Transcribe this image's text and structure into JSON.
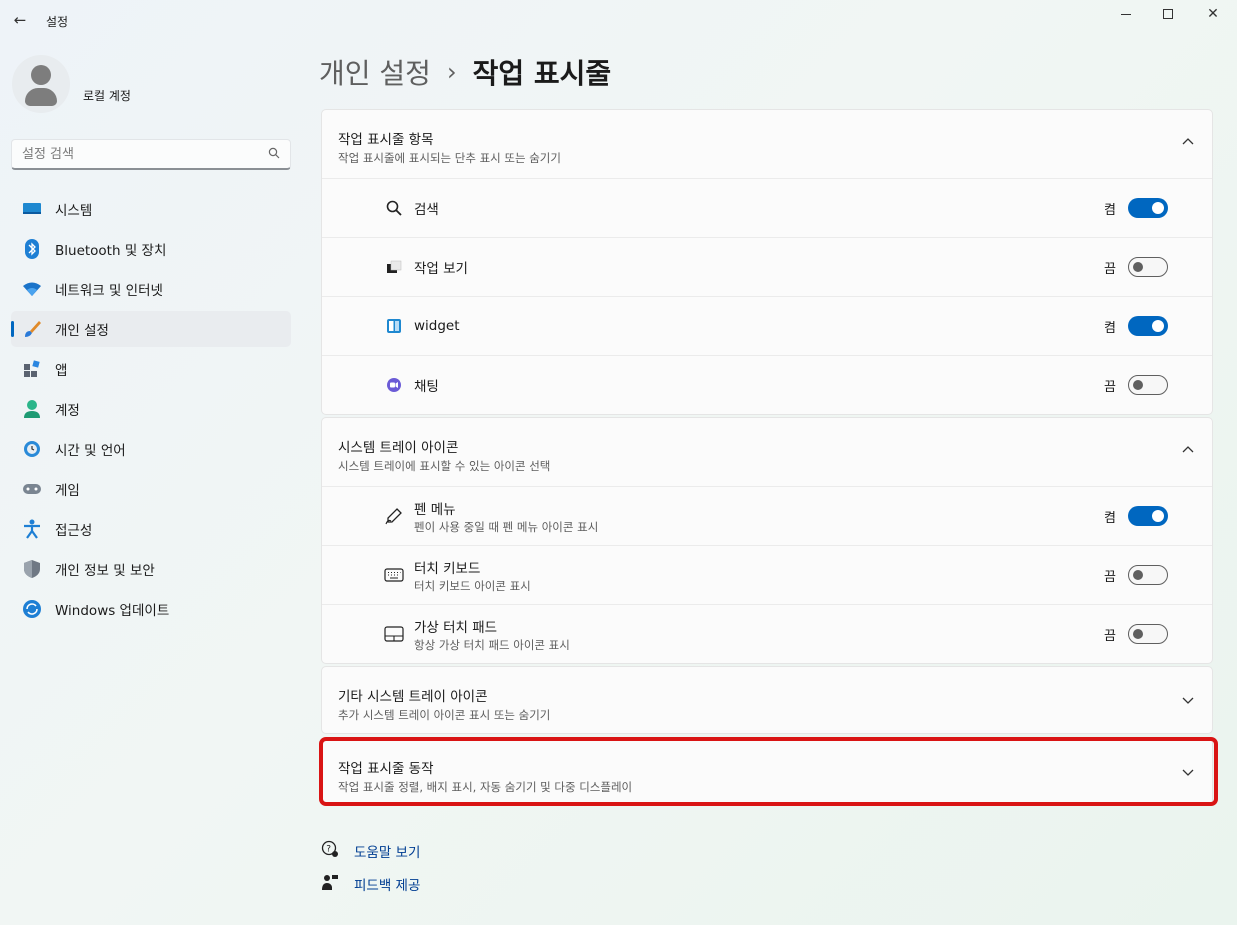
{
  "window": {
    "title": "설정",
    "back_icon": "←",
    "minimize_icon": "—",
    "maximize_icon": "☐",
    "close_icon": "✕"
  },
  "profile": {
    "name": "로컬 계정"
  },
  "search": {
    "placeholder": "설정 검색",
    "icon": "⌕"
  },
  "sidebar": {
    "items": [
      {
        "label": "시스템",
        "icon": "system-icon",
        "active": false
      },
      {
        "label": "Bluetooth 및 장치",
        "icon": "bluetooth-icon",
        "active": false
      },
      {
        "label": "네트워크 및 인터넷",
        "icon": "wifi-icon",
        "active": false
      },
      {
        "label": "개인 설정",
        "icon": "brush-icon",
        "active": true
      },
      {
        "label": "앱",
        "icon": "apps-icon",
        "active": false
      },
      {
        "label": "계정",
        "icon": "account-icon",
        "active": false
      },
      {
        "label": "시간 및 언어",
        "icon": "globe-clock-icon",
        "active": false
      },
      {
        "label": "게임",
        "icon": "gamepad-icon",
        "active": false
      },
      {
        "label": "접근성",
        "icon": "accessibility-icon",
        "active": false
      },
      {
        "label": "개인 정보 및 보안",
        "icon": "shield-icon",
        "active": false
      },
      {
        "label": "Windows 업데이트",
        "icon": "update-icon",
        "active": false
      }
    ]
  },
  "breadcrumb": {
    "parent": "개인 설정",
    "separator": "›",
    "current": "작업 표시줄"
  },
  "taskbar_items": {
    "title": "작업 표시줄 항목",
    "subtitle": "작업 표시줄에 표시되는 단추 표시 또는 숨기기",
    "rows": [
      {
        "label": "검색",
        "state": "켬",
        "on": true
      },
      {
        "label": "작업 보기",
        "state": "끔",
        "on": false
      },
      {
        "label": "widget",
        "state": "켬",
        "on": true
      },
      {
        "label": "채팅",
        "state": "끔",
        "on": false
      }
    ]
  },
  "tray_icons": {
    "title": "시스템 트레이 아이콘",
    "subtitle": "시스템 트레이에 표시할 수 있는 아이콘 선택",
    "rows": [
      {
        "label": "펜 메뉴",
        "desc": "펜이 사용 중일 때 펜 메뉴 아이콘 표시",
        "state": "켬",
        "on": true
      },
      {
        "label": "터치 키보드",
        "desc": "터치 키보드 아이콘 표시",
        "state": "끔",
        "on": false
      },
      {
        "label": "가상 터치 패드",
        "desc": "항상 가상 터치 패드 아이콘 표시",
        "state": "끔",
        "on": false
      }
    ]
  },
  "other_tray": {
    "title": "기타 시스템 트레이 아이콘",
    "subtitle": "추가 시스템 트레이 아이콘 표시 또는 숨기기"
  },
  "behaviors": {
    "title": "작업 표시줄 동작",
    "subtitle": "작업 표시줄 정렬, 배지 표시, 자동 숨기기 및 다중 디스플레이"
  },
  "footer": {
    "help": "도움말 보기",
    "feedback": "피드백 제공"
  },
  "colors": {
    "accent": "#0067c0",
    "highlight": "#d91414"
  }
}
